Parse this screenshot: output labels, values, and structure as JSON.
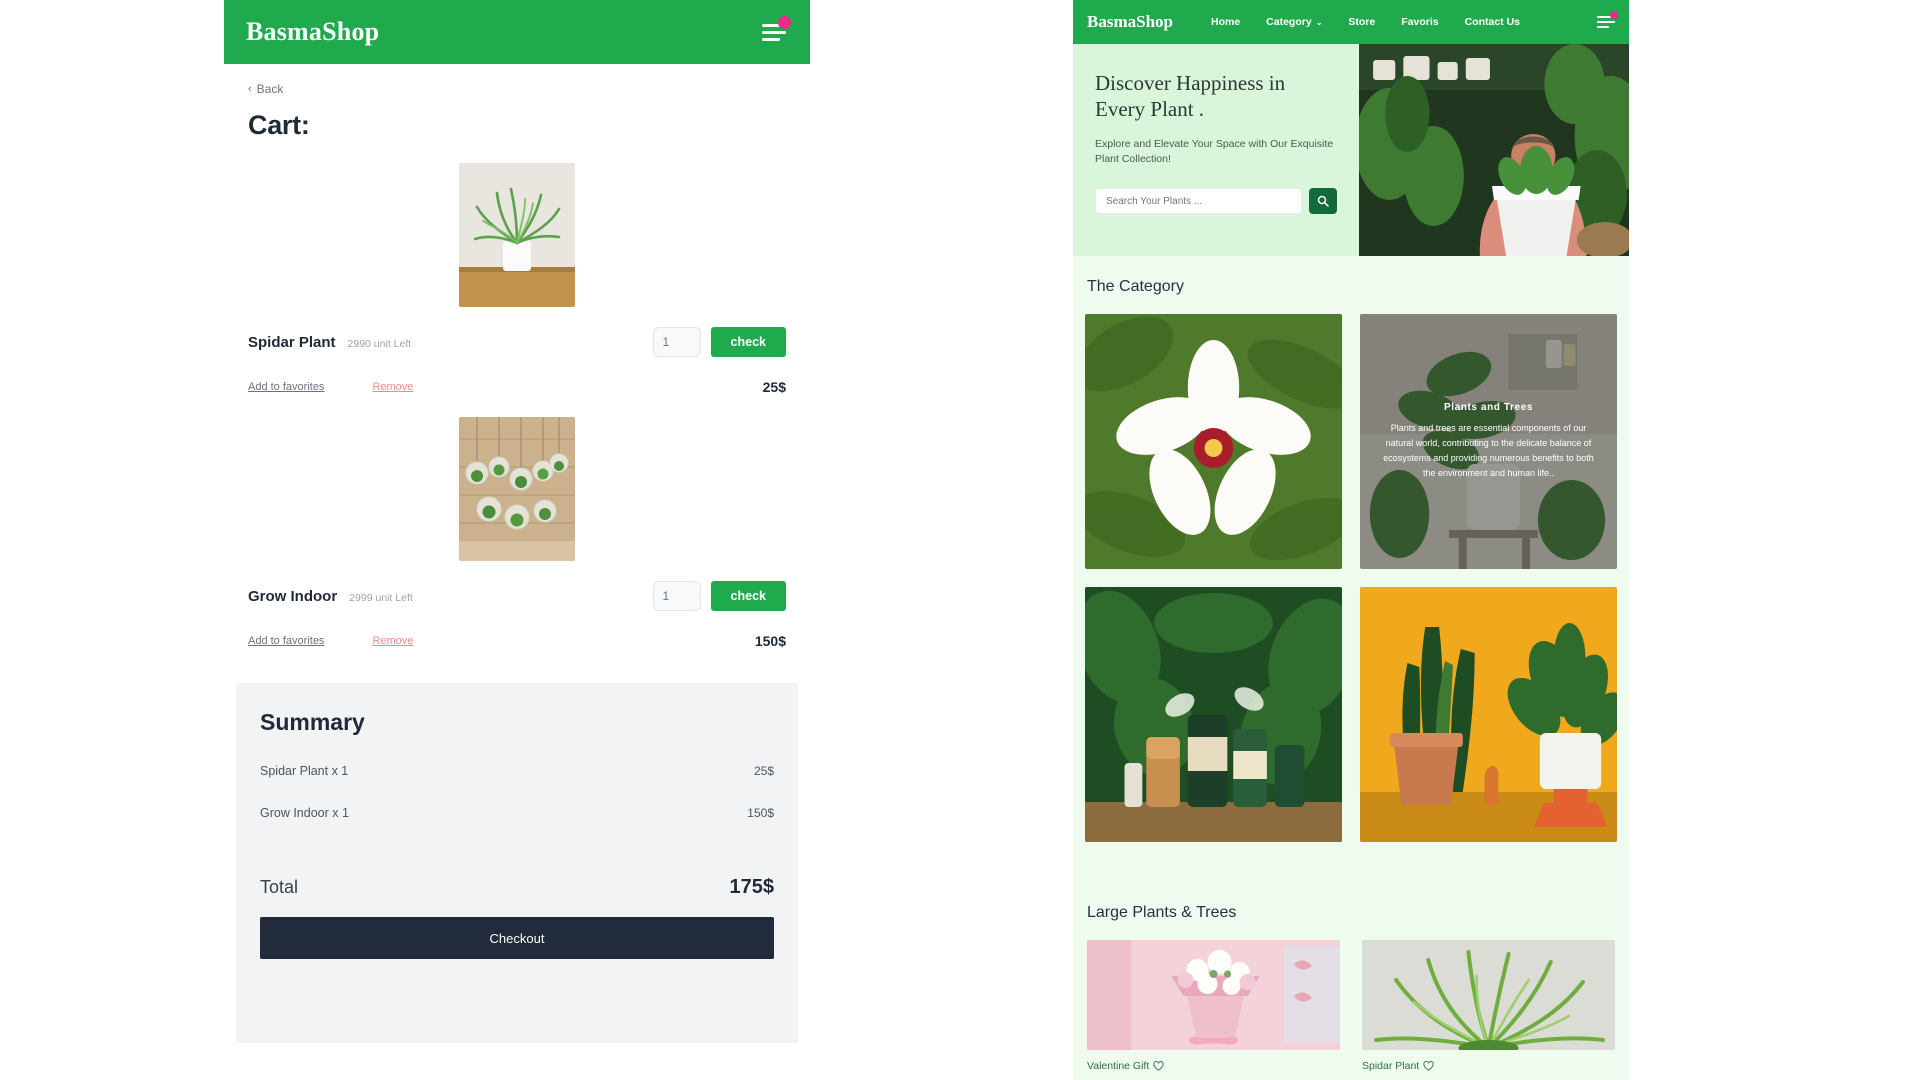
{
  "cart_page": {
    "header": {
      "brand": "BasmaShop",
      "menu_icon": "hamburger-icon",
      "badge_icon": "notification-dot"
    },
    "back_label": "Back",
    "back_chevron": "‹",
    "title": "Cart:",
    "items": [
      {
        "name": "Spidar Plant",
        "stock": "2990 unit Left",
        "qty": "1",
        "check_label": "check",
        "favorite_label": "Add to favorites",
        "remove_label": "Remove",
        "price": "25$"
      },
      {
        "name": "Grow Indoor",
        "stock": "2999 unit Left",
        "qty": "1",
        "check_label": "check",
        "favorite_label": "Add to favorites",
        "remove_label": "Remove",
        "price": "150$"
      }
    ],
    "summary": {
      "title": "Summary",
      "lines": [
        {
          "label": "Spidar Plant x 1",
          "value": "25$"
        },
        {
          "label": "Grow Indoor x 1",
          "value": "150$"
        }
      ],
      "total_label": "Total",
      "total_value": "175$",
      "checkout_label": "Checkout"
    }
  },
  "store_page": {
    "nav": {
      "brand": "BasmaShop",
      "links": [
        {
          "label": "Home"
        },
        {
          "label": "Category",
          "chevron": "⌄"
        },
        {
          "label": "Store"
        },
        {
          "label": "Favoris"
        },
        {
          "label": "Contact Us"
        }
      ],
      "menu_icon": "hamburger-icon",
      "badge_icon": "notification-dot"
    },
    "hero": {
      "title_line1": "Discover Happiness in",
      "title_line2": "Every Plant .",
      "subtitle": "Explore and Elevate Your Space with Our Exquisite Plant Collection!",
      "search_placeholder": "Search Your Plants ...",
      "search_icon": "search-icon"
    },
    "category_section": {
      "title": "The Category",
      "cards": [
        {
          "name": "flower-category-card",
          "overlay": false
        },
        {
          "name": "plants-and-trees-category-card",
          "overlay": true,
          "overlay_title": "Plants and Trees",
          "overlay_text": "Plants and trees are essential components of our natural world, contributing to the delicate balance of ecosystems and providing numerous benefits to both the environment and human life.."
        },
        {
          "name": "plant-care-category-card",
          "overlay": false
        },
        {
          "name": "indoor-plants-category-card",
          "overlay": false
        }
      ]
    },
    "large_section": {
      "title": "Large Plants & Trees",
      "products": [
        {
          "label": "Valentine Gift",
          "favorite_icon": "heart-icon"
        },
        {
          "label": "Spidar Plant",
          "favorite_icon": "heart-icon"
        }
      ]
    }
  },
  "colors": {
    "brand_green": "#1faa4e",
    "dark_green": "#156a3a",
    "hero_bg": "#d9f5da",
    "page_bg": "#eefbee",
    "summary_bg": "#f2f3f5",
    "checkout_bg": "#222b3b",
    "badge_pink": "#ec2a8b",
    "remove_red": "#f08a8a"
  }
}
